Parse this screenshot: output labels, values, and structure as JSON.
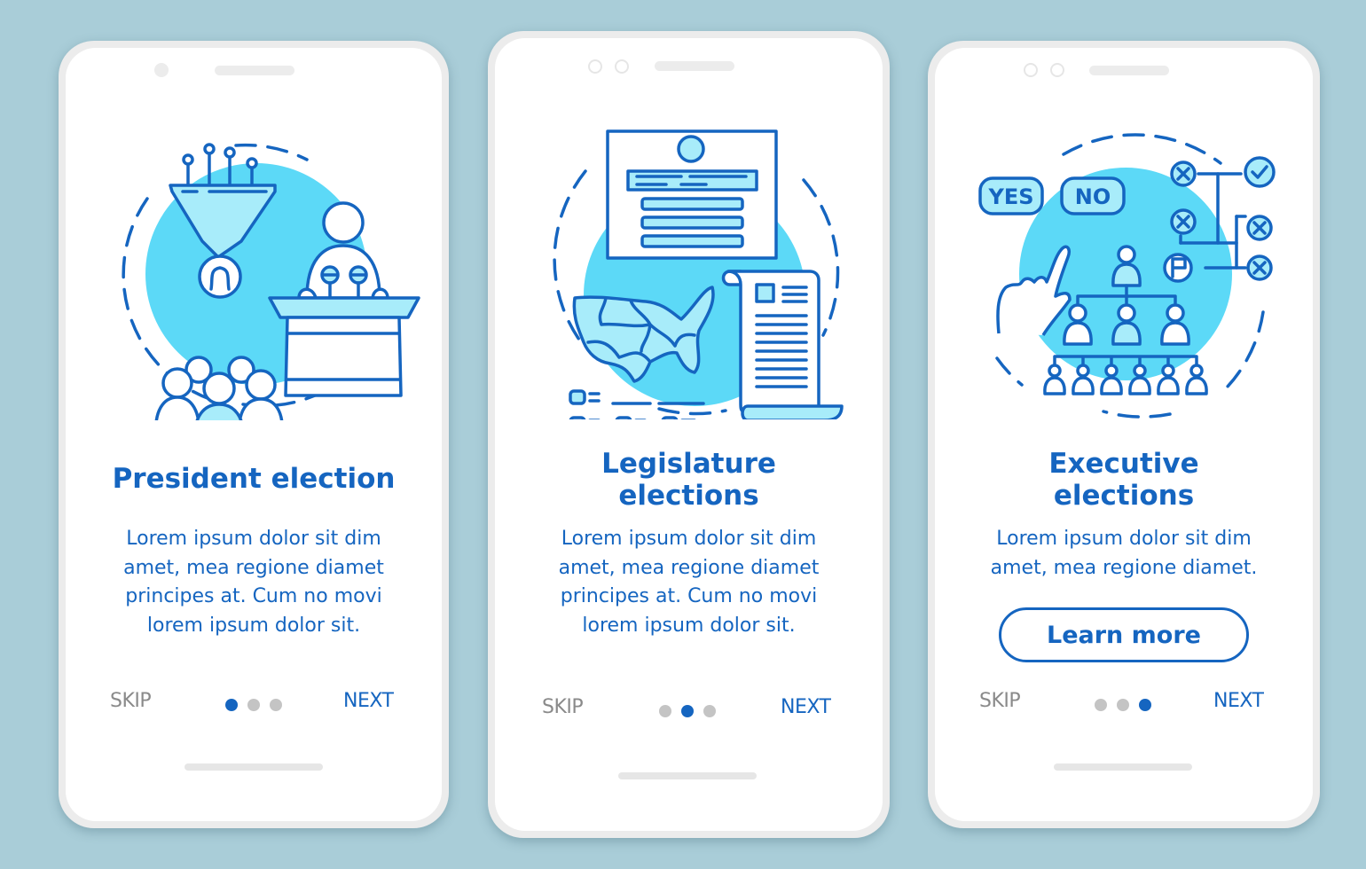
{
  "colors": {
    "background": "#a9cdd8",
    "accent": "#1565c0",
    "illustration_fill": "#5cd9f7",
    "illustration_light": "#a8ecfa",
    "muted_text": "#8a8a8a",
    "inactive_dot": "#c4c4c4"
  },
  "screens": [
    {
      "illustration": "president-election-illustration",
      "icons": [
        "funnel-icon",
        "user-circle-icon",
        "crowd-icon",
        "speaker-podium-icon",
        "microphone-icon"
      ],
      "title": "President election",
      "description": "Lorem ipsum dolor sit dim\namet, mea regione diamet\nprincipes at. Cum no movi\nlorem ipsum dolor sit.",
      "skip_label": "SKIP",
      "next_label": "NEXT",
      "page_indicator": {
        "current": 1,
        "total": 3
      }
    },
    {
      "illustration": "legislature-elections-illustration",
      "icons": [
        "ballot-card-icon",
        "map-icon",
        "document-scroll-icon",
        "legend-icon"
      ],
      "title": "Legislature\nelections",
      "description": "Lorem ipsum dolor sit dim\namet, mea regione diamet\nprincipes at. Cum no movi\nlorem ipsum dolor sit.",
      "skip_label": "SKIP",
      "next_label": "NEXT",
      "page_indicator": {
        "current": 2,
        "total": 3
      }
    },
    {
      "illustration": "executive-elections-illustration",
      "icons": [
        "yes-bubble-icon",
        "no-bubble-icon",
        "pointing-hand-icon",
        "hierarchy-icon",
        "bracket-icon",
        "check-icon",
        "x-icon",
        "flag-icon"
      ],
      "title": "Executive\nelections",
      "description": "Lorem ipsum dolor sit dim\namet, mea regione diamet.",
      "yes_label": "YES",
      "no_label": "NO",
      "button_label": "Learn more",
      "skip_label": "SKIP",
      "next_label": "NEXT",
      "page_indicator": {
        "current": 3,
        "total": 3
      }
    }
  ]
}
